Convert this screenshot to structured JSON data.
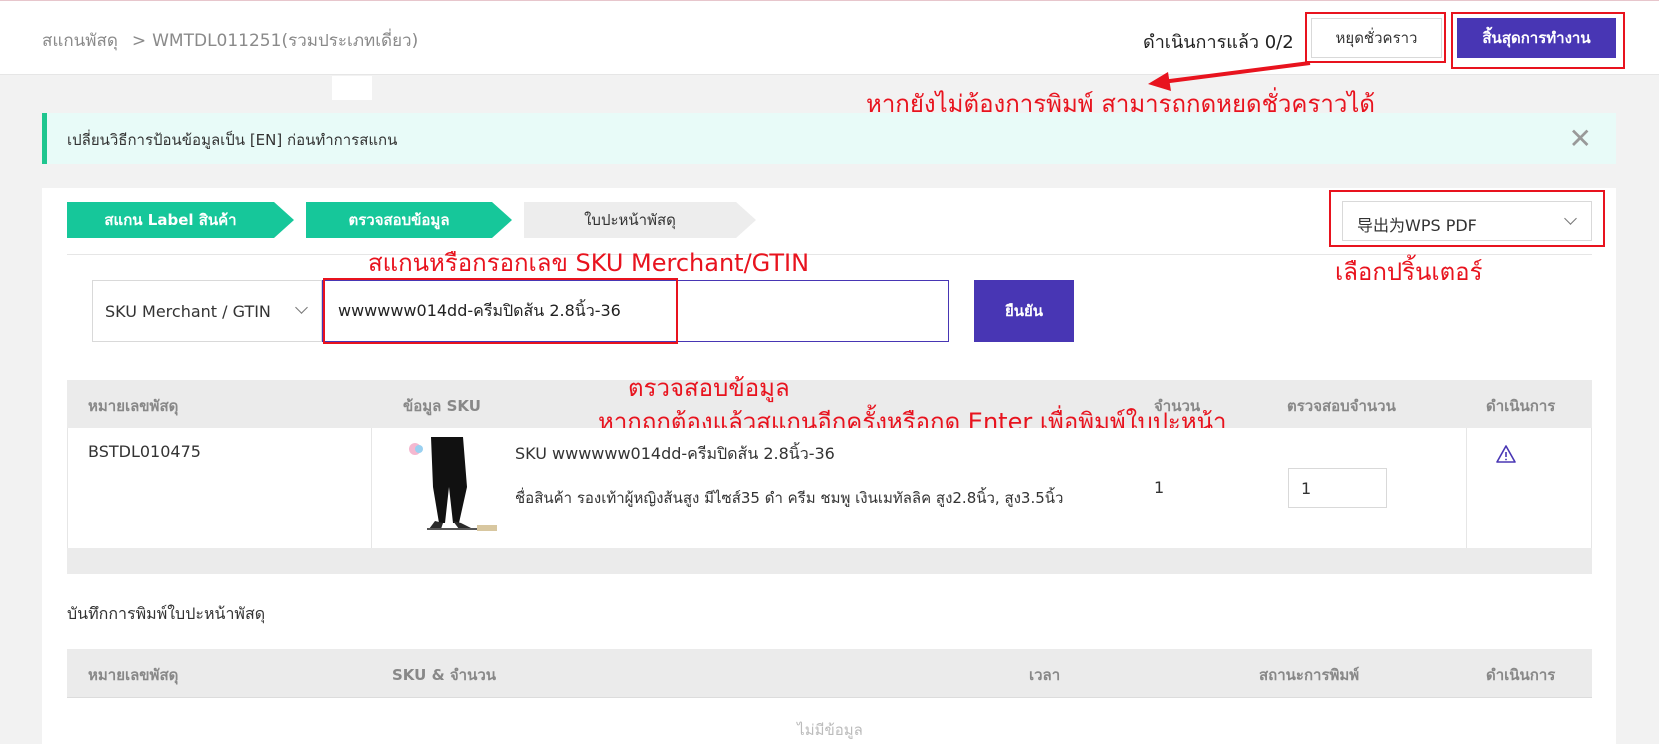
{
  "header": {
    "breadcrumb_root": "สแกนพัสดุ",
    "breadcrumb_sep": ">",
    "breadcrumb_current": "WMTDL011251(รวมประเภทเดี่ยว)",
    "progress_text": "ดำเนินการแล้ว 0/2",
    "pause_label": "หยุดชั่วคราว",
    "finish_label": "สิ้นสุดการทำงาน"
  },
  "notice": {
    "text": "เปลี่ยนวิธีการป้อนข้อมูลเป็น [EN] ก่อนทำการสแกน",
    "close_glyph": "✕"
  },
  "steps": [
    {
      "label": "สแกน Label สินค้า"
    },
    {
      "label": "ตรวจสอบข้อมูล"
    },
    {
      "label": "ใบปะหน้าพัสดุ"
    }
  ],
  "printer": {
    "selected": "导出为WPS PDF"
  },
  "scan": {
    "field_type": "SKU Merchant / GTIN",
    "value": "wwwwww014dd-ครีมปิดส้น 2.8นิ้ว-36",
    "confirm_label": "ยืนยัน"
  },
  "annotations": {
    "pause_hint": "หากยังไม่ต้องการพิมพ์ สามารถกดหยุดชั่วคราวได้",
    "printer_hint": "เลือกปริ้นเตอร์",
    "scan_hint": "สแกนหรือกรอกเลข SKU Merchant/GTIN",
    "check_hint_1": "ตรวจสอบข้อมูล",
    "check_hint_2": "หากถูกต้องแล้วสแกนอีกครั้งหรือกด Enter เพื่อพิมพ์ใบปะหน้า"
  },
  "table": {
    "columns": [
      "หมายเลขพัสดุ",
      "ข้อมูล SKU",
      "จำนวน",
      "ตรวจสอบจำนวน",
      "ดำเนินการ"
    ],
    "rows": [
      {
        "parcel_no": "BSTDL010475",
        "sku": "SKU wwwwww014dd-ครีมปิดส้น 2.8นิ้ว-36",
        "product_name": "ชื่อสินค้า รองเท้าผู้หญิงส้นสูง มีไซส์35 ดำ ครีม ชมพู เงินเมทัลลิค สูง2.8นิ้ว, สูง3.5นิ้ว",
        "qty": "1",
        "checked_qty": "1"
      }
    ]
  },
  "log": {
    "title": "บันทึกการพิมพ์ใบปะหน้าพัสดุ",
    "columns": [
      "หมายเลขพัสดุ",
      "SKU & จำนวน",
      "เวลา",
      "สถานะการพิมพ์",
      "ดำเนินการ"
    ],
    "empty_text": "ไม่มีข้อมูล"
  },
  "colors": {
    "brand": "#4836b4",
    "step_active": "#16c79a",
    "annotation": "#e8131e",
    "notice_bg": "#e8fbf8"
  }
}
